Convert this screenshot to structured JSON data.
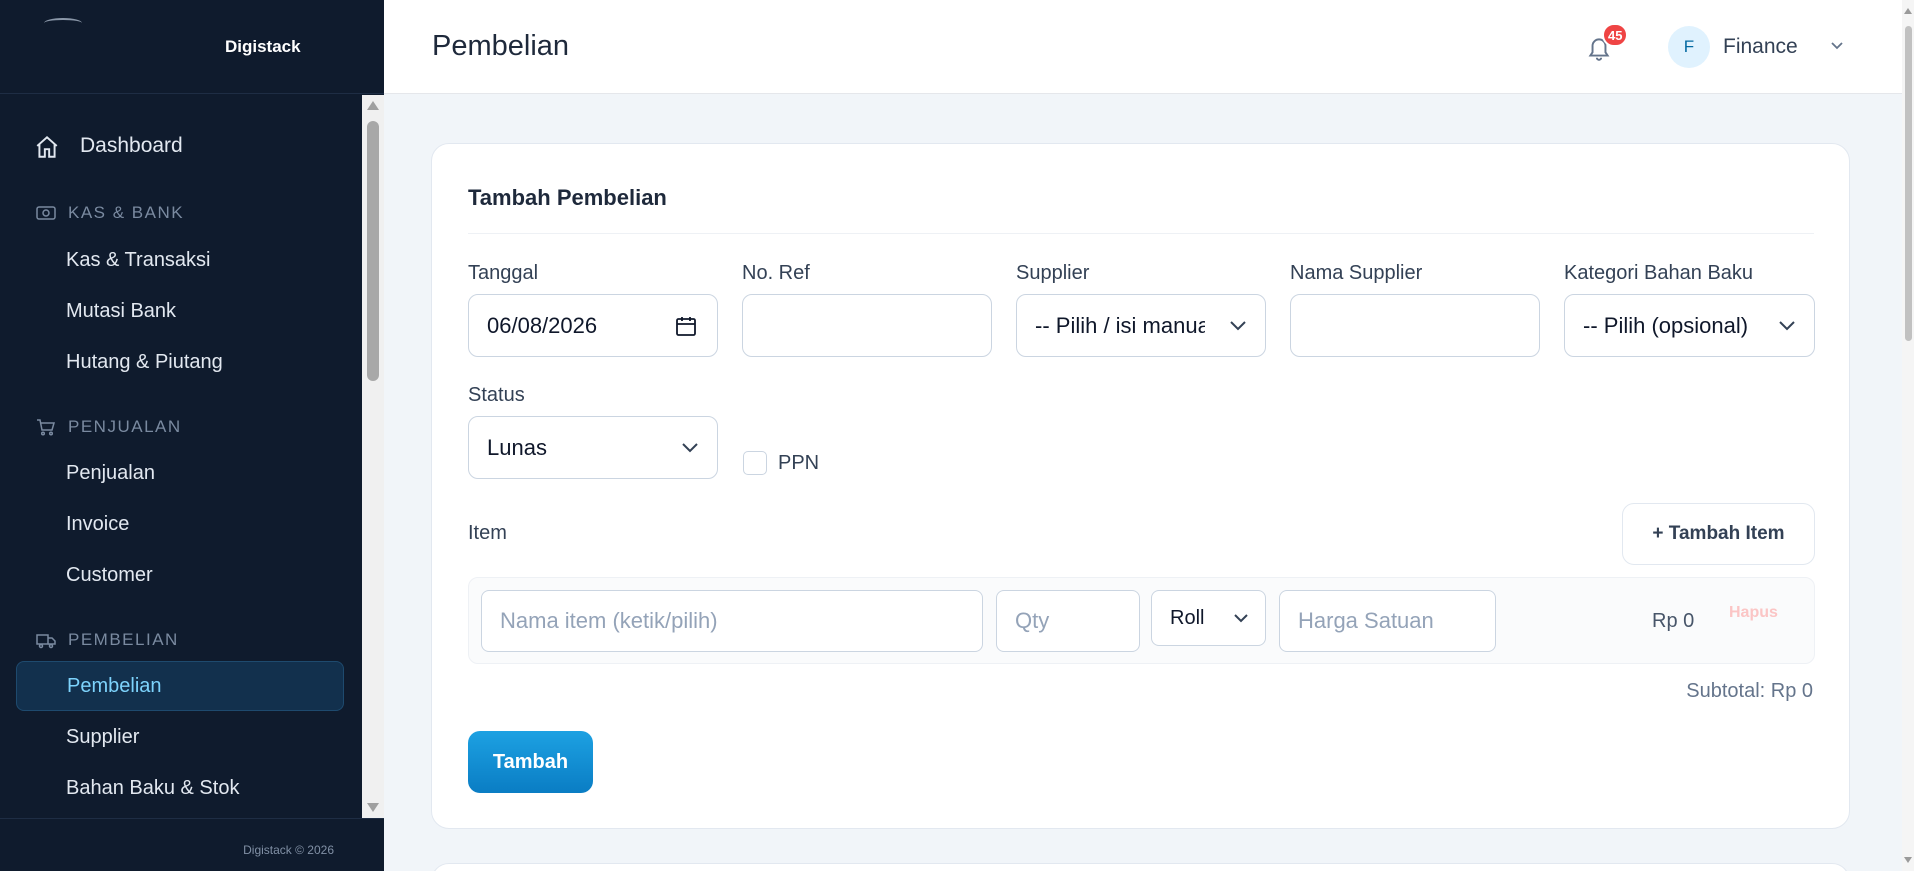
{
  "brand": {
    "name": "Digistack"
  },
  "sidebar": {
    "dashboard": "Dashboard",
    "sections": [
      {
        "title": "KAS & BANK",
        "icon": "cash-icon",
        "items": [
          "Kas & Transaksi",
          "Mutasi Bank",
          "Hutang & Piutang"
        ]
      },
      {
        "title": "PENJUALAN",
        "icon": "cart-icon",
        "items": [
          "Penjualan",
          "Invoice",
          "Customer"
        ]
      },
      {
        "title": "PEMBELIAN",
        "icon": "truck-icon",
        "items": [
          "Pembelian",
          "Supplier",
          "Bahan Baku & Stok"
        ]
      }
    ],
    "active": "Pembelian",
    "footer": "Digistack © 2026"
  },
  "header": {
    "title": "Pembelian",
    "notification_count": "45",
    "user_initial": "F",
    "user_name": "Finance"
  },
  "form": {
    "title": "Tambah Pembelian",
    "tanggal": {
      "label": "Tanggal",
      "value": "06/08/2026"
    },
    "noref": {
      "label": "No. Ref",
      "value": ""
    },
    "supplier": {
      "label": "Supplier",
      "value": "-- Pilih / isi manual --"
    },
    "nama_supplier": {
      "label": "Nama Supplier",
      "value": ""
    },
    "kategori": {
      "label": "Kategori Bahan Baku",
      "value": "-- Pilih (opsional) --"
    },
    "status": {
      "label": "Status",
      "value": "Lunas"
    },
    "ppn": {
      "label": "PPN",
      "checked": false
    },
    "item_label": "Item",
    "add_item": "+ Tambah Item",
    "row": {
      "name_placeholder": "Nama item (ketik/pilih)",
      "qty_placeholder": "Qty",
      "unit": "Roll",
      "price_placeholder": "Harga Satuan",
      "total": "Rp 0",
      "delete": "Hapus"
    },
    "subtotal": "Subtotal: Rp 0",
    "submit": "Tambah"
  },
  "colors": {
    "sidebar_bg": "#0f1b2d",
    "active_text": "#7dd3fc",
    "primary": "#0ea5e9",
    "badge": "#ef4444"
  }
}
